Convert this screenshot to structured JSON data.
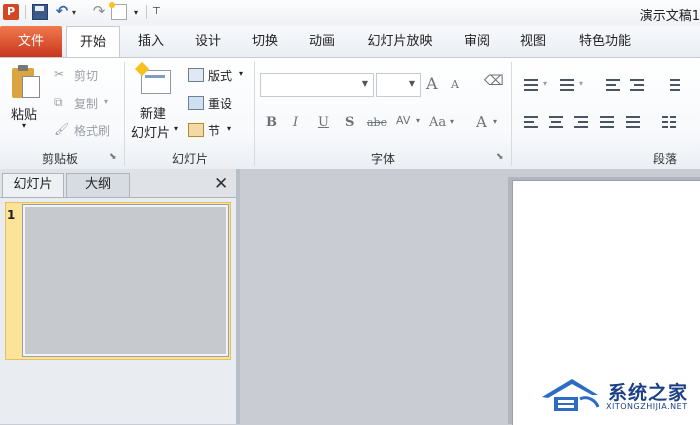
{
  "app": {
    "logo_letter": "P",
    "doc_title": "演示文稿1"
  },
  "qat": {
    "undo": "↶",
    "redo": "↷",
    "dropdown": "▾",
    "customize": "⊤"
  },
  "tabs": [
    {
      "label": "文件"
    },
    {
      "label": "开始"
    },
    {
      "label": "插入"
    },
    {
      "label": "设计"
    },
    {
      "label": "切换"
    },
    {
      "label": "动画"
    },
    {
      "label": "幻灯片放映"
    },
    {
      "label": "审阅"
    },
    {
      "label": "视图"
    },
    {
      "label": "特色功能"
    }
  ],
  "clipboard": {
    "paste": "粘贴",
    "cut": "剪切",
    "copy": "复制",
    "format_painter": "格式刷",
    "group_label": "剪贴板"
  },
  "slides": {
    "new_slide_line1": "新建",
    "new_slide_line2": "幻灯片",
    "layout": "版式",
    "reset": "重设",
    "section": "节",
    "group_label": "幻灯片"
  },
  "font": {
    "group_label": "字体",
    "font_name": "",
    "font_size": "",
    "grow": "A",
    "shrink": "A",
    "bold": "B",
    "italic": "I",
    "underline": "U",
    "shadow": "S",
    "strikethrough": "abc",
    "spacing": "AV",
    "change_case": "Aa",
    "color": "A"
  },
  "paragraph": {
    "group_label": "段落"
  },
  "panel": {
    "tab_slides": "幻灯片",
    "tab_outline": "大纲",
    "close": "✕",
    "slide_number": "1"
  },
  "watermark": {
    "title": "系统之家",
    "subtitle": "XITONGZHIJIA.NET"
  }
}
